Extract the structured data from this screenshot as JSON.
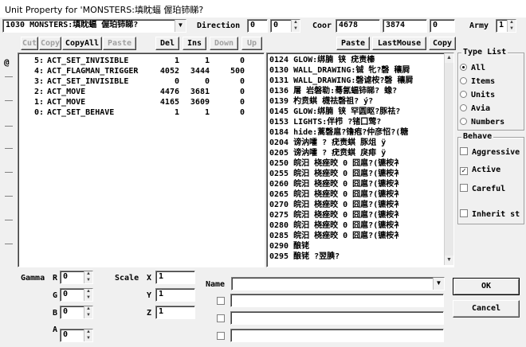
{
  "window": {
    "title": "Unit Property for 'MONSTERS:填眈蝠 偓珀铈睇?"
  },
  "unit": {
    "selector": "1030 MONSTERS:填眈蝠 偓珀铈睇?",
    "direction_label": "Direction",
    "direction_a": "0",
    "direction_b": "0",
    "coor_label": "Coor",
    "coor_x": "4678",
    "coor_y": "3874",
    "coor_z": "0",
    "army_label": "Army",
    "army": "1"
  },
  "toolbar_left": {
    "cut": "Cut",
    "copy": "Copy",
    "copyall": "CopyAll",
    "paste": "Paste",
    "del": "Del",
    "ins": "Ins",
    "down": "Down",
    "up": "Up"
  },
  "toolbar_right": {
    "paste": "Paste",
    "lastmouse": "LastMouse",
    "copy": "Copy"
  },
  "left_side_glyph": "@",
  "actions": [
    {
      "idx": "5:",
      "name": "ACT_SET_INVISIBLE",
      "a": "1",
      "b": "1",
      "c": "0"
    },
    {
      "idx": "4:",
      "name": "ACT_FLAGMAN_TRIGGER",
      "a": "4052",
      "b": "3444",
      "c": "500"
    },
    {
      "idx": "3:",
      "name": "ACT_SET_INVISIBLE",
      "a": "0",
      "b": "0",
      "c": "0"
    },
    {
      "idx": "2:",
      "name": "ACT_MOVE",
      "a": "4476",
      "b": "3681",
      "c": "0"
    },
    {
      "idx": "1:",
      "name": "ACT_MOVE",
      "a": "4165",
      "b": "3609",
      "c": "0"
    },
    {
      "idx": "0:",
      "name": "ACT_SET_BEHAVE",
      "a": "1",
      "b": "1",
      "c": "0"
    }
  ],
  "types": [
    "0124 GLOW:绑腩 铗 疣责榛",
    "0130 WALL_DRAWING:铖 牝?磬 穰屙",
    "0131 WALL_DRAWING:磬谑桉?磬 穰屙",
    "0136 屠 岩磐勒:蓦氤蝠铈睇? 蟓?",
    "0139 杓贲蜞 櫗祛磬祖? ý?",
    "0145 GLOW:绑腩 铗 罕圆眍?豚祛?",
    "0153 LIGHTS:伴栉 ?锗囗莺?",
    "0184 hide:蒿磬扈?镥疱?仲彦怊?(糖",
    "0204 谤汭嚯 ? 疣责蜞 豚俎 ÿ",
    "0205 谤汭嚯 ? 疣贲蜞 戾痱 ÿ",
    "0250 皖汨 桡痤晈 0 囧扈?(镳桉衤",
    "0255 皖汨 桡痤晈 0 囧扈?(镳桉衤",
    "0260 皖汨 桡痤晈 0 囧扈?(镳桉衤",
    "0265 皖汨 桡痤晈 0 囧扈?(镳桉衤",
    "0270 皖汨 桡痤晈 0 囧扈?(镳桉衤",
    "0275 皖汨 桡痤晈 0 囧扈?(镳桉衤",
    "0280 皖汨 桡痤晈 0 囧扈?(镳桉衤",
    "0285 皖汨 桡痤晈 0 囧扈?(镳桉衤",
    "0290 酿铑",
    "0295 酿铑 ?翌腆?"
  ],
  "type_list": {
    "title": "Type List",
    "options": [
      "All",
      "Items",
      "Units",
      "Avia",
      "Numbers"
    ],
    "selected": "All"
  },
  "behave": {
    "title": "Behave",
    "aggressive": "Aggressive",
    "active": "Active",
    "careful": "Careful",
    "inherit": "Inherit st",
    "aggressive_checked": false,
    "active_checked": true,
    "careful_checked": false,
    "inherit_checked": false
  },
  "gamma": {
    "label": "Gamma",
    "r_label": "R",
    "r": "0",
    "g_label": "G",
    "g": "0",
    "b_label": "B",
    "b": "0",
    "a_label": "A",
    "a": "0"
  },
  "scale": {
    "label": "Scale",
    "x_label": "X",
    "x": "1",
    "y_label": "Y",
    "y": "1",
    "z_label": "Z",
    "z": "1"
  },
  "name_field": {
    "label": "Name",
    "value": ""
  },
  "buttons": {
    "ok": "OK",
    "cancel": "Cancel"
  }
}
